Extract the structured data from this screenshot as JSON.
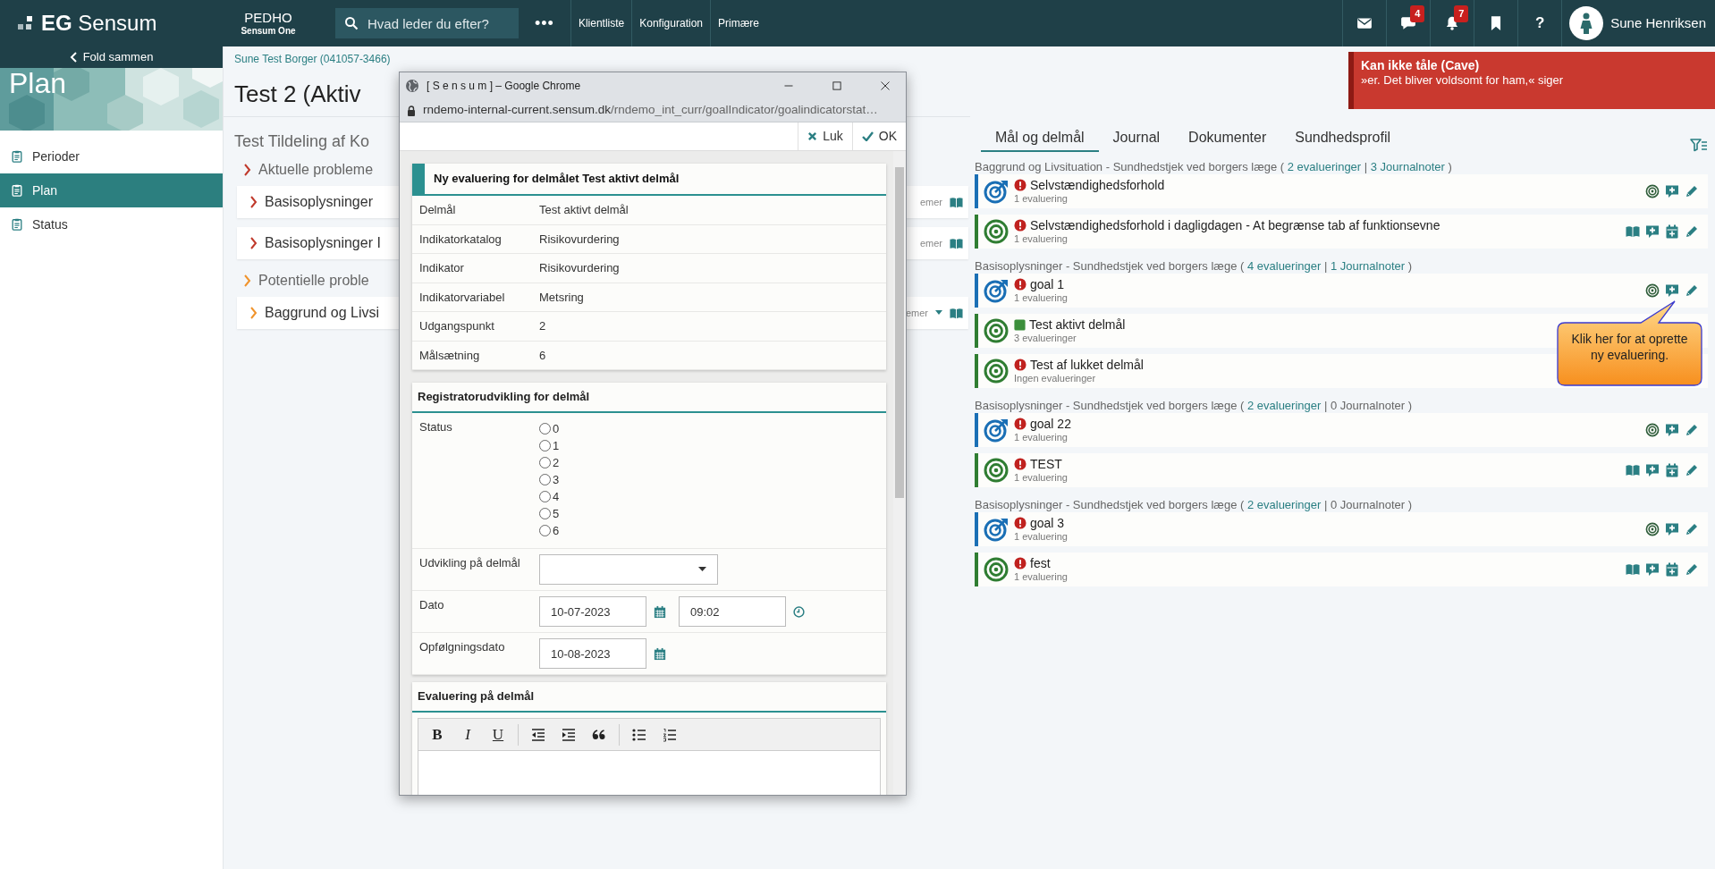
{
  "topbar": {
    "logo": "**EG** Sensum",
    "org": "PEDHO",
    "product": "Sensum One",
    "search": {
      "placeholder": "Hvad leder du efter?"
    },
    "more": "•••",
    "links": [
      "Klientliste",
      "Konfiguration",
      "Primære"
    ],
    "icons": [
      {
        "kind": "mail"
      },
      {
        "kind": "chat",
        "badge": "4"
      },
      {
        "kind": "bell",
        "badge": "7"
      },
      {
        "kind": "bookmark"
      },
      {
        "kind": "help",
        "label": "?"
      }
    ],
    "user": "Sune Henriksen"
  },
  "sidebar": {
    "collapse": "Fold sammen",
    "heading": "Plan",
    "items": [
      {
        "label": "Perioder",
        "selected": false
      },
      {
        "label": "Plan",
        "selected": true
      },
      {
        "label": "Status",
        "selected": false
      }
    ]
  },
  "main": {
    "breadcrumb": "Sune Test Borger (041057-3466)",
    "title": "Test 2 (Aktiv",
    "subtitle": "Test Tildeling af Ko",
    "items": [
      {
        "kind": "section",
        "label": "Aktuelle probleme",
        "color": "#c0392b"
      },
      {
        "kind": "card",
        "label": "Basisoplysninger",
        "color": "#c0392b",
        "tail": "emer"
      },
      {
        "kind": "card",
        "label": "Basisoplysninger I",
        "color": "#c0392b",
        "tail": "emer"
      },
      {
        "kind": "section",
        "label": "Potentielle proble",
        "color": "#f0932b"
      },
      {
        "kind": "card",
        "label": "Baggrund og Livsi",
        "color": "#f0932b",
        "tail": "emer",
        "tail_caret": true
      }
    ]
  },
  "alert": {
    "title": "Kan ikke tåle (Cave)",
    "text": "»er. Det bliver voldsomt for ham,« siger"
  },
  "tabs": [
    {
      "label": "Mål og delmål",
      "selected": true
    },
    {
      "label": "Journal",
      "selected": false
    },
    {
      "label": "Dokumenter",
      "selected": false
    },
    {
      "label": "Sundhedsprofil",
      "selected": false
    }
  ],
  "groups": [
    {
      "header": [
        {
          "kind": "text",
          "text": "Baggrund og Livsituation - Sundhedstjek ved borgers læge ( "
        },
        {
          "kind": "link",
          "text": "2 evalueringer"
        },
        {
          "kind": "text",
          "text": " |  "
        },
        {
          "kind": "link",
          "text": "3 Journalnoter"
        },
        {
          "kind": "text",
          "text": " )"
        }
      ],
      "items": [
        {
          "kind": "goal",
          "status": {
            "kind": "alert"
          },
          "title": "Selvstændighedsforhold",
          "count": "1 evaluering",
          "actions": [
            {
              "kind": "target"
            },
            {
              "kind": "comment"
            },
            {
              "kind": "edit"
            }
          ]
        },
        {
          "kind": "subgoal",
          "status": {
            "kind": "alert"
          },
          "title": "Selvstændighedsforhold i dagligdagen - At begrænse tab af funktionsevne",
          "count": "1 evaluering",
          "actions": [
            {
              "kind": "book"
            },
            {
              "kind": "comment"
            },
            {
              "kind": "calendar"
            },
            {
              "kind": "edit"
            }
          ]
        }
      ]
    },
    {
      "header": [
        {
          "kind": "text",
          "text": "Basisoplysninger - Sundhedstjek ved borgers læge ( "
        },
        {
          "kind": "link",
          "text": "4 evalueringer"
        },
        {
          "kind": "text",
          "text": " |  "
        },
        {
          "kind": "link",
          "text": "1 Journalnoter"
        },
        {
          "kind": "text",
          "text": " )"
        }
      ],
      "items": [
        {
          "kind": "goal",
          "status": {
            "kind": "alert"
          },
          "title": "goal 1",
          "count": "1 evaluering",
          "actions": [
            {
              "kind": "target"
            },
            {
              "kind": "comment"
            },
            {
              "kind": "edit"
            }
          ],
          "callout": "Klik her for at oprette\nny evaluering."
        },
        {
          "kind": "subgoal",
          "status": {
            "kind": "active"
          },
          "title": "Test aktivt delmål",
          "count": "3 evalueringer"
        },
        {
          "kind": "subgoal",
          "status": {
            "kind": "alert"
          },
          "title": "Test af lukket delmål",
          "count": "Ingen evalueringer"
        }
      ]
    },
    {
      "header": [
        {
          "kind": "text",
          "text": "Basisoplysninger - Sundhedstjek ved borgers læge ( "
        },
        {
          "kind": "link",
          "text": "2 evalueringer"
        },
        {
          "kind": "text",
          "text": " | 0 Journalnoter )"
        }
      ],
      "items": [
        {
          "kind": "goal",
          "status": {
            "kind": "alert"
          },
          "title": "goal 22",
          "count": "1 evaluering",
          "actions": [
            {
              "kind": "target"
            },
            {
              "kind": "comment"
            },
            {
              "kind": "edit"
            }
          ]
        },
        {
          "kind": "subgoal",
          "status": {
            "kind": "alert"
          },
          "title": "TEST",
          "count": "1 evaluering",
          "actions": [
            {
              "kind": "book"
            },
            {
              "kind": "comment"
            },
            {
              "kind": "calendar"
            },
            {
              "kind": "edit"
            }
          ]
        }
      ]
    },
    {
      "header": [
        {
          "kind": "text",
          "text": "Basisoplysninger - Sundhedstjek ved borgers læge ( "
        },
        {
          "kind": "link",
          "text": "2 evalueringer"
        },
        {
          "kind": "text",
          "text": " | 0 Journalnoter )"
        }
      ],
      "items": [
        {
          "kind": "goal",
          "status": {
            "kind": "alert"
          },
          "title": "goal 3",
          "count": "1 evaluering",
          "actions": [
            {
              "kind": "target"
            },
            {
              "kind": "comment"
            },
            {
              "kind": "edit"
            }
          ]
        },
        {
          "kind": "subgoal",
          "status": {
            "kind": "alert"
          },
          "title": "fest",
          "count": "1 evaluering",
          "actions": [
            {
              "kind": "book"
            },
            {
              "kind": "comment"
            },
            {
              "kind": "calendar"
            },
            {
              "kind": "edit"
            }
          ]
        }
      ]
    }
  ],
  "popup": {
    "window_title": "[ S e n s u m ] – Google Chrome",
    "url_host": "rndemo-internal-current.sensum.dk",
    "url_path": "/rndemo_int_curr/goalIndicator/goalindicatorstat…",
    "actions": [
      {
        "kind": "close",
        "label": "Luk"
      },
      {
        "kind": "ok",
        "label": "OK"
      }
    ],
    "heading": "Ny evaluering for delmålet Test aktivt delmål",
    "details": [
      {
        "label": "Delmål",
        "value": "Test aktivt delmål"
      },
      {
        "label": "Indikatorkatalog",
        "value": "Risikovurdering"
      },
      {
        "label": "Indikator",
        "value": "Risikovurdering"
      },
      {
        "label": "Indikatorvariabel",
        "value": "Metsring"
      },
      {
        "label": "Udgangspunkt",
        "value": "2"
      },
      {
        "label": "Målsætning",
        "value": "6"
      }
    ],
    "registration": {
      "heading": "Registratorudvikling for delmål",
      "fields": [
        {
          "kind": "radios",
          "label": "Status",
          "options": [
            {
              "label": "0",
              "selected": false
            },
            {
              "label": "1",
              "selected": false
            },
            {
              "label": "2",
              "selected": false
            },
            {
              "label": "3",
              "selected": false
            },
            {
              "label": "4",
              "selected": false
            },
            {
              "label": "5",
              "selected": false
            },
            {
              "label": "6",
              "selected": false
            }
          ]
        },
        {
          "kind": "select",
          "label": "Udvikling på delmål"
        },
        {
          "kind": "datetime",
          "label": "Dato",
          "date": "10-07-2023",
          "time": "09:02"
        },
        {
          "kind": "date",
          "label": "Opfølgningsdato",
          "date": "10-08-2023"
        }
      ]
    },
    "evaluation": {
      "heading": "Evaluering på delmål",
      "tools": [
        {
          "kind": "bold",
          "label": "B"
        },
        {
          "kind": "italic",
          "label": "I"
        },
        {
          "kind": "underline",
          "label": "U"
        },
        {
          "kind": "outdent",
          "divider_before": true
        },
        {
          "kind": "indent"
        },
        {
          "kind": "quote"
        },
        {
          "kind": "bullets",
          "divider_before": true
        },
        {
          "kind": "numbers"
        }
      ]
    }
  }
}
